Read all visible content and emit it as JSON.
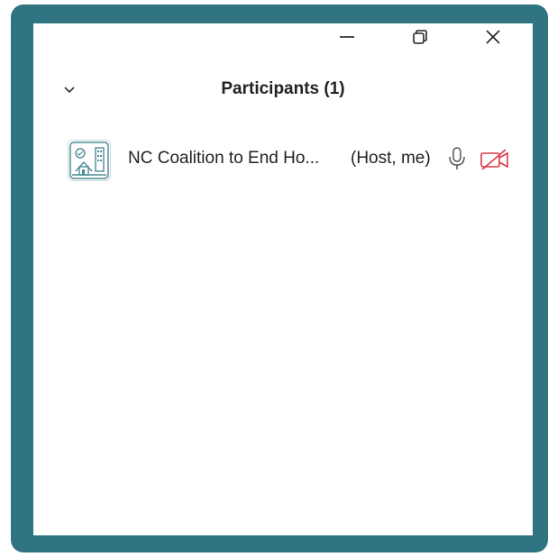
{
  "window": {
    "controls": {
      "minimize_icon": "minimize-icon",
      "restore_icon": "restore-icon",
      "close_icon": "close-icon"
    }
  },
  "panel": {
    "title": "Participants (1)",
    "collapse_icon": "chevron-down-icon"
  },
  "participants": [
    {
      "name": "NC Coalition to End Ho...",
      "role": "(Host, me)",
      "avatar_icon": "organization-logo",
      "mic_icon": "microphone-icon",
      "camera_icon": "video-off-icon",
      "camera_status_color": "#d93a46"
    }
  ],
  "colors": {
    "frame": "#2f7480",
    "panel_background": "#ffffff"
  }
}
